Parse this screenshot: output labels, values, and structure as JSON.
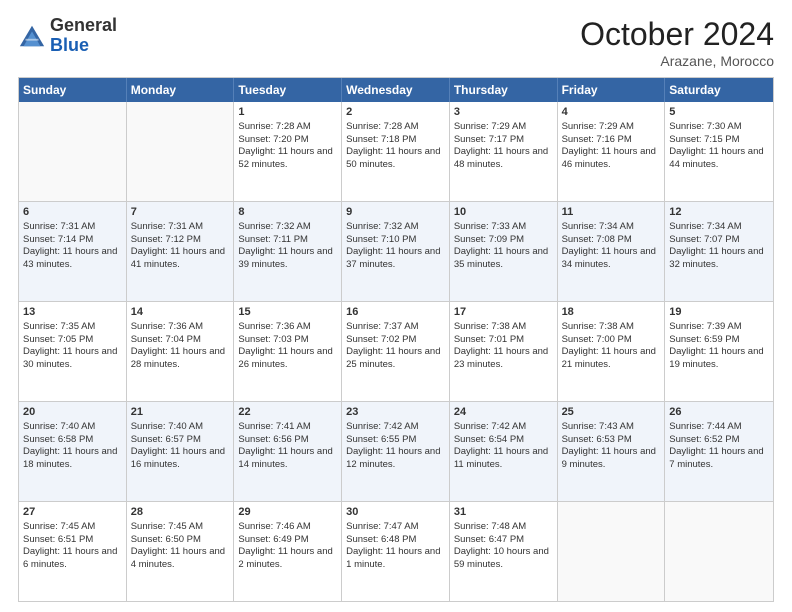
{
  "logo": {
    "general": "General",
    "blue": "Blue"
  },
  "title": "October 2024",
  "location": "Arazane, Morocco",
  "days_of_week": [
    "Sunday",
    "Monday",
    "Tuesday",
    "Wednesday",
    "Thursday",
    "Friday",
    "Saturday"
  ],
  "weeks": [
    [
      {
        "day": "",
        "sunrise": "",
        "sunset": "",
        "daylight": "",
        "empty": true
      },
      {
        "day": "",
        "sunrise": "",
        "sunset": "",
        "daylight": "",
        "empty": true
      },
      {
        "day": "1",
        "sunrise": "Sunrise: 7:28 AM",
        "sunset": "Sunset: 7:20 PM",
        "daylight": "Daylight: 11 hours and 52 minutes.",
        "empty": false
      },
      {
        "day": "2",
        "sunrise": "Sunrise: 7:28 AM",
        "sunset": "Sunset: 7:18 PM",
        "daylight": "Daylight: 11 hours and 50 minutes.",
        "empty": false
      },
      {
        "day": "3",
        "sunrise": "Sunrise: 7:29 AM",
        "sunset": "Sunset: 7:17 PM",
        "daylight": "Daylight: 11 hours and 48 minutes.",
        "empty": false
      },
      {
        "day": "4",
        "sunrise": "Sunrise: 7:29 AM",
        "sunset": "Sunset: 7:16 PM",
        "daylight": "Daylight: 11 hours and 46 minutes.",
        "empty": false
      },
      {
        "day": "5",
        "sunrise": "Sunrise: 7:30 AM",
        "sunset": "Sunset: 7:15 PM",
        "daylight": "Daylight: 11 hours and 44 minutes.",
        "empty": false
      }
    ],
    [
      {
        "day": "6",
        "sunrise": "Sunrise: 7:31 AM",
        "sunset": "Sunset: 7:14 PM",
        "daylight": "Daylight: 11 hours and 43 minutes.",
        "empty": false
      },
      {
        "day": "7",
        "sunrise": "Sunrise: 7:31 AM",
        "sunset": "Sunset: 7:12 PM",
        "daylight": "Daylight: 11 hours and 41 minutes.",
        "empty": false
      },
      {
        "day": "8",
        "sunrise": "Sunrise: 7:32 AM",
        "sunset": "Sunset: 7:11 PM",
        "daylight": "Daylight: 11 hours and 39 minutes.",
        "empty": false
      },
      {
        "day": "9",
        "sunrise": "Sunrise: 7:32 AM",
        "sunset": "Sunset: 7:10 PM",
        "daylight": "Daylight: 11 hours and 37 minutes.",
        "empty": false
      },
      {
        "day": "10",
        "sunrise": "Sunrise: 7:33 AM",
        "sunset": "Sunset: 7:09 PM",
        "daylight": "Daylight: 11 hours and 35 minutes.",
        "empty": false
      },
      {
        "day": "11",
        "sunrise": "Sunrise: 7:34 AM",
        "sunset": "Sunset: 7:08 PM",
        "daylight": "Daylight: 11 hours and 34 minutes.",
        "empty": false
      },
      {
        "day": "12",
        "sunrise": "Sunrise: 7:34 AM",
        "sunset": "Sunset: 7:07 PM",
        "daylight": "Daylight: 11 hours and 32 minutes.",
        "empty": false
      }
    ],
    [
      {
        "day": "13",
        "sunrise": "Sunrise: 7:35 AM",
        "sunset": "Sunset: 7:05 PM",
        "daylight": "Daylight: 11 hours and 30 minutes.",
        "empty": false
      },
      {
        "day": "14",
        "sunrise": "Sunrise: 7:36 AM",
        "sunset": "Sunset: 7:04 PM",
        "daylight": "Daylight: 11 hours and 28 minutes.",
        "empty": false
      },
      {
        "day": "15",
        "sunrise": "Sunrise: 7:36 AM",
        "sunset": "Sunset: 7:03 PM",
        "daylight": "Daylight: 11 hours and 26 minutes.",
        "empty": false
      },
      {
        "day": "16",
        "sunrise": "Sunrise: 7:37 AM",
        "sunset": "Sunset: 7:02 PM",
        "daylight": "Daylight: 11 hours and 25 minutes.",
        "empty": false
      },
      {
        "day": "17",
        "sunrise": "Sunrise: 7:38 AM",
        "sunset": "Sunset: 7:01 PM",
        "daylight": "Daylight: 11 hours and 23 minutes.",
        "empty": false
      },
      {
        "day": "18",
        "sunrise": "Sunrise: 7:38 AM",
        "sunset": "Sunset: 7:00 PM",
        "daylight": "Daylight: 11 hours and 21 minutes.",
        "empty": false
      },
      {
        "day": "19",
        "sunrise": "Sunrise: 7:39 AM",
        "sunset": "Sunset: 6:59 PM",
        "daylight": "Daylight: 11 hours and 19 minutes.",
        "empty": false
      }
    ],
    [
      {
        "day": "20",
        "sunrise": "Sunrise: 7:40 AM",
        "sunset": "Sunset: 6:58 PM",
        "daylight": "Daylight: 11 hours and 18 minutes.",
        "empty": false
      },
      {
        "day": "21",
        "sunrise": "Sunrise: 7:40 AM",
        "sunset": "Sunset: 6:57 PM",
        "daylight": "Daylight: 11 hours and 16 minutes.",
        "empty": false
      },
      {
        "day": "22",
        "sunrise": "Sunrise: 7:41 AM",
        "sunset": "Sunset: 6:56 PM",
        "daylight": "Daylight: 11 hours and 14 minutes.",
        "empty": false
      },
      {
        "day": "23",
        "sunrise": "Sunrise: 7:42 AM",
        "sunset": "Sunset: 6:55 PM",
        "daylight": "Daylight: 11 hours and 12 minutes.",
        "empty": false
      },
      {
        "day": "24",
        "sunrise": "Sunrise: 7:42 AM",
        "sunset": "Sunset: 6:54 PM",
        "daylight": "Daylight: 11 hours and 11 minutes.",
        "empty": false
      },
      {
        "day": "25",
        "sunrise": "Sunrise: 7:43 AM",
        "sunset": "Sunset: 6:53 PM",
        "daylight": "Daylight: 11 hours and 9 minutes.",
        "empty": false
      },
      {
        "day": "26",
        "sunrise": "Sunrise: 7:44 AM",
        "sunset": "Sunset: 6:52 PM",
        "daylight": "Daylight: 11 hours and 7 minutes.",
        "empty": false
      }
    ],
    [
      {
        "day": "27",
        "sunrise": "Sunrise: 7:45 AM",
        "sunset": "Sunset: 6:51 PM",
        "daylight": "Daylight: 11 hours and 6 minutes.",
        "empty": false
      },
      {
        "day": "28",
        "sunrise": "Sunrise: 7:45 AM",
        "sunset": "Sunset: 6:50 PM",
        "daylight": "Daylight: 11 hours and 4 minutes.",
        "empty": false
      },
      {
        "day": "29",
        "sunrise": "Sunrise: 7:46 AM",
        "sunset": "Sunset: 6:49 PM",
        "daylight": "Daylight: 11 hours and 2 minutes.",
        "empty": false
      },
      {
        "day": "30",
        "sunrise": "Sunrise: 7:47 AM",
        "sunset": "Sunset: 6:48 PM",
        "daylight": "Daylight: 11 hours and 1 minute.",
        "empty": false
      },
      {
        "day": "31",
        "sunrise": "Sunrise: 7:48 AM",
        "sunset": "Sunset: 6:47 PM",
        "daylight": "Daylight: 10 hours and 59 minutes.",
        "empty": false
      },
      {
        "day": "",
        "sunrise": "",
        "sunset": "",
        "daylight": "",
        "empty": true
      },
      {
        "day": "",
        "sunrise": "",
        "sunset": "",
        "daylight": "",
        "empty": true
      }
    ]
  ]
}
